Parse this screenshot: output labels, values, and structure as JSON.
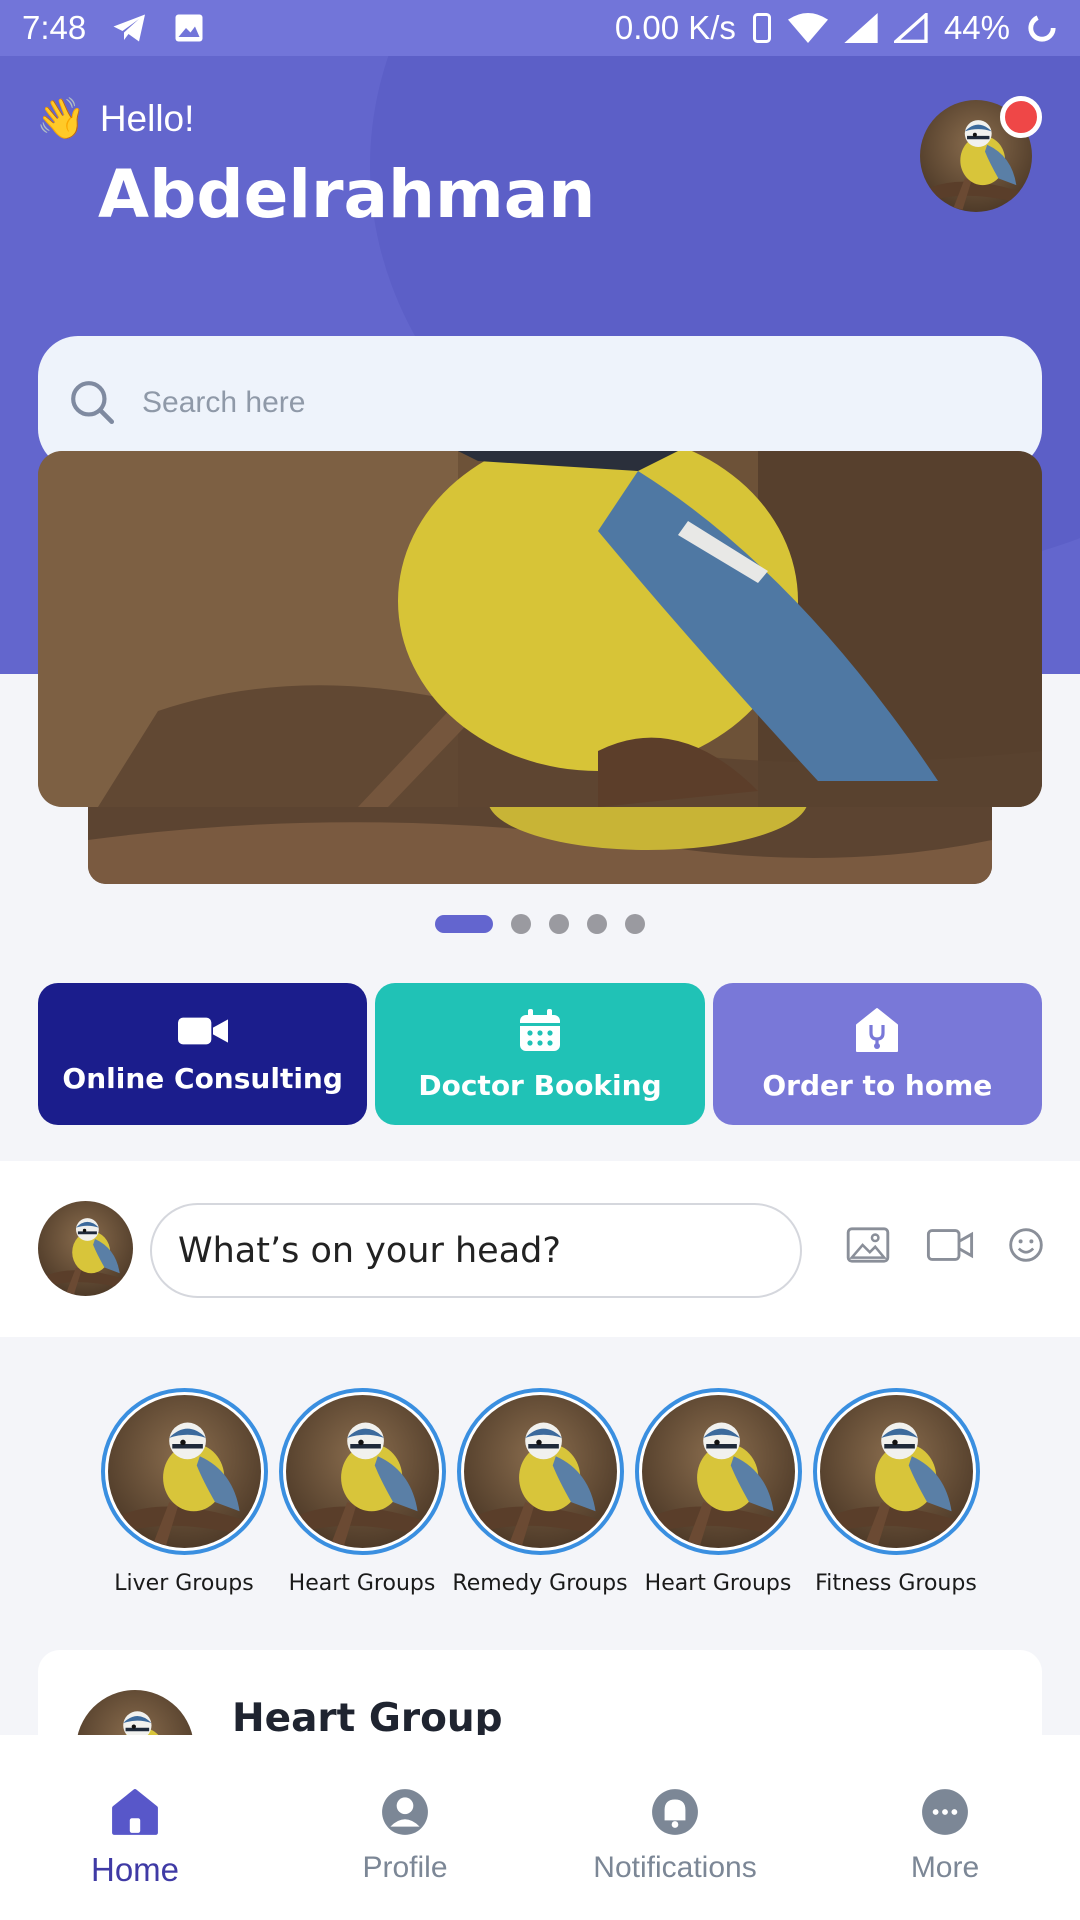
{
  "status_bar": {
    "time": "7:48",
    "speed": "0.00 K/s",
    "battery": "44%"
  },
  "header": {
    "greeting": "Hello!",
    "wave_emoji": "👋",
    "user_name": "Abdelrahman",
    "notification_color": "#ef4747"
  },
  "search": {
    "placeholder": "Search here"
  },
  "carousel": {
    "slides": 5,
    "active_index": 0
  },
  "services": [
    {
      "label": "Online Consulting",
      "icon": "video-camera-icon",
      "color": "#1b1d8c"
    },
    {
      "label": "Doctor Booking",
      "icon": "calendar-icon",
      "color": "#20c2b6"
    },
    {
      "label": "Order to home",
      "icon": "home-stethoscope-icon",
      "color": "#7978d8"
    }
  ],
  "composer": {
    "placeholder": "What’s on your head?"
  },
  "groups": [
    {
      "label": "Liver Groups"
    },
    {
      "label": "Heart Groups"
    },
    {
      "label": "Remedy Groups"
    },
    {
      "label": "Heart Groups"
    },
    {
      "label": "Fitness Groups"
    }
  ],
  "post": {
    "title": "Heart Group"
  },
  "bottom_nav": [
    {
      "label": "Home",
      "icon": "home-icon",
      "active": true
    },
    {
      "label": "Profile",
      "icon": "profile-icon",
      "active": false
    },
    {
      "label": "Notifications",
      "icon": "bell-icon",
      "active": false
    },
    {
      "label": "More",
      "icon": "more-icon",
      "active": false
    }
  ],
  "colors": {
    "primary": "#6366cd",
    "ring": "#3a8fe0"
  }
}
